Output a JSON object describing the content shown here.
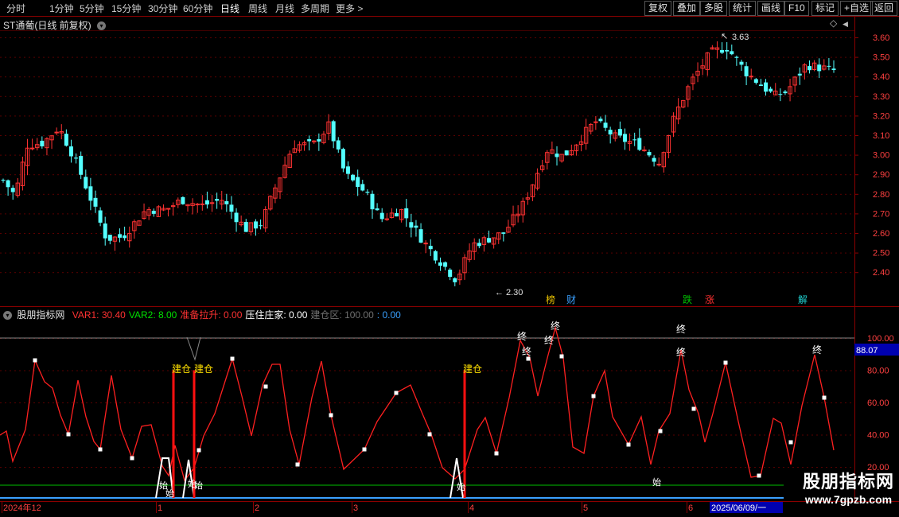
{
  "toolbar": {
    "periods": [
      "分时",
      "1分钟",
      "5分钟",
      "15分钟",
      "30分钟",
      "60分钟",
      "日线",
      "周线",
      "月线",
      "多周期",
      "更多"
    ],
    "active_period": "日线",
    "more_arrow": ">",
    "right_buttons": [
      "复权",
      "叠加",
      "多股",
      "统计",
      "画线",
      "F10",
      "标记",
      "+自选",
      "返回"
    ]
  },
  "main_chart": {
    "title": "ST通葡(日线 前复权)",
    "high_label": "3.63",
    "low_label": "2.30",
    "event_markers": [
      {
        "text": "榜",
        "color": "#e8c000"
      },
      {
        "text": "财",
        "color": "#3aa0ff"
      },
      {
        "text": "跌",
        "color": "#00c000"
      },
      {
        "text": "涨",
        "color": "#ff3030"
      },
      {
        "text": "解",
        "color": "#20d0d0"
      }
    ],
    "price_axis": [
      "3.60",
      "3.50",
      "3.40",
      "3.30",
      "3.20",
      "3.10",
      "3.00",
      "2.90",
      "2.80",
      "2.70",
      "2.60",
      "2.50",
      "2.40"
    ],
    "colors": {
      "up": "#ff3232",
      "down": "#54ffff"
    }
  },
  "indicator": {
    "name": "股朋指标网",
    "legend": [
      {
        "label": "VAR1: 30.40",
        "color": "#ff3232"
      },
      {
        "label": "VAR2: 8.00",
        "color": "#00e000"
      },
      {
        "label": "准备拉升: 0.00",
        "color": "#ff3232"
      },
      {
        "label": "压住庄家: 0.00",
        "color": "#ffffff"
      },
      {
        "label": "建仓区: 100.00",
        "color": "#707070"
      },
      {
        "label": ": 0.00",
        "color": "#3aa0ff"
      }
    ],
    "axis": [
      "100.00",
      "80.00",
      "60.00",
      "40.00",
      "20.00"
    ],
    "current_value": "88.07",
    "labels": {
      "build": "建仓",
      "end": "终",
      "start": "始"
    }
  },
  "date_axis": {
    "labels": [
      "2024年12",
      "1",
      "2",
      "3",
      "4",
      "5",
      "6"
    ],
    "cursor_date": "2025/06/09/一"
  },
  "watermark": {
    "text": "股朋指标网",
    "url": "www.7gpzb.com"
  }
}
